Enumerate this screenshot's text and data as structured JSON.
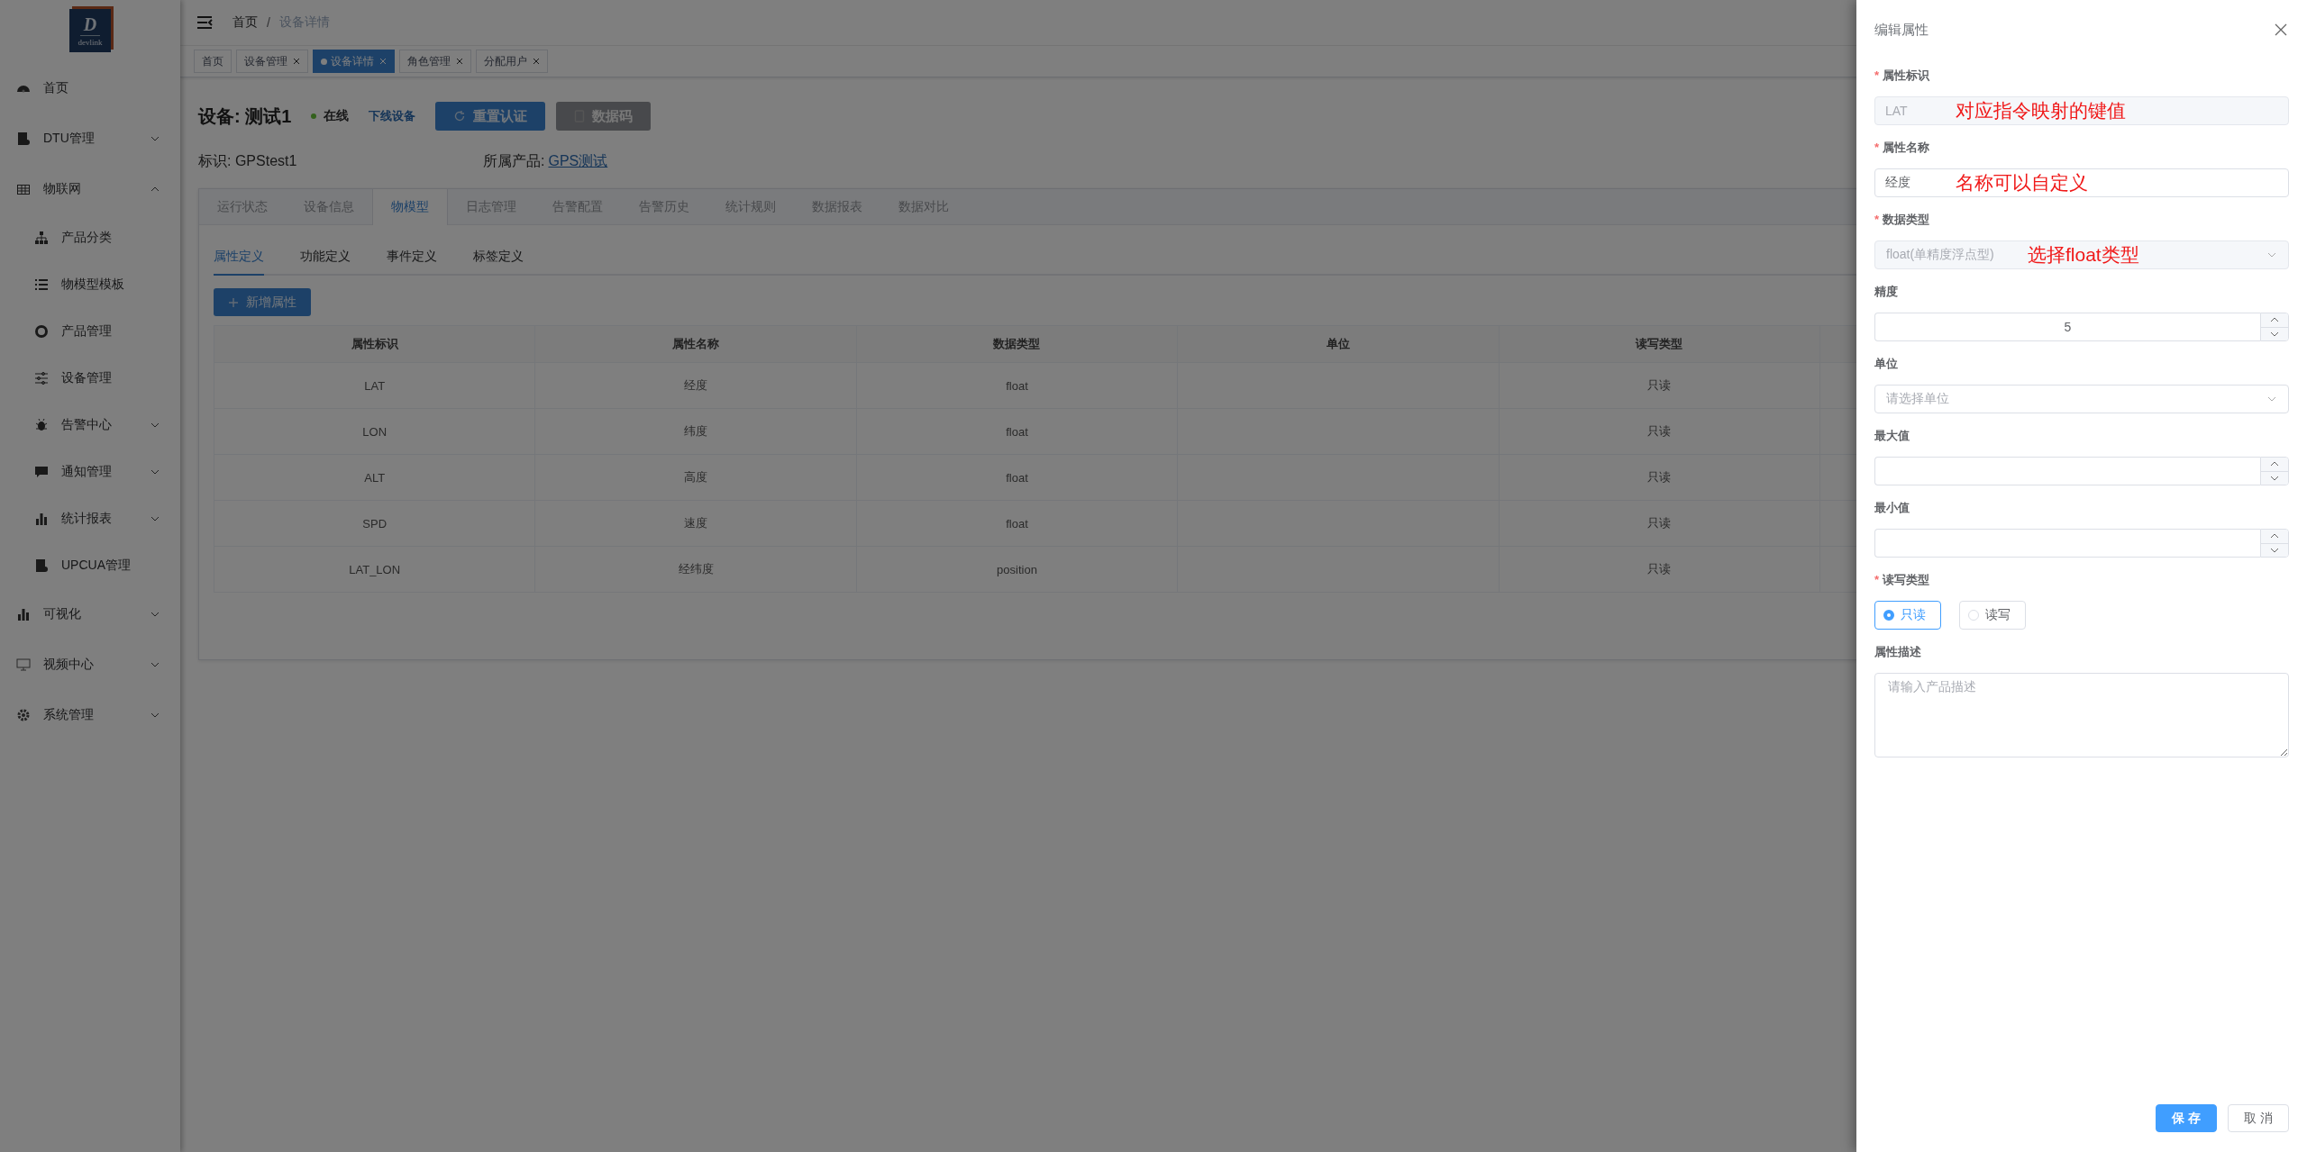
{
  "sidebar": {
    "logo": {
      "letter": "D",
      "text": "devlink"
    },
    "items": [
      {
        "label": "首页"
      },
      {
        "label": "DTU管理",
        "expanded": false
      },
      {
        "label": "物联网",
        "expanded": true,
        "children": [
          {
            "label": "产品分类"
          },
          {
            "label": "物模型模板"
          },
          {
            "label": "产品管理"
          },
          {
            "label": "设备管理"
          },
          {
            "label": "告警中心",
            "expanded": false
          },
          {
            "label": "通知管理",
            "expanded": false
          },
          {
            "label": "统计报表",
            "expanded": false
          },
          {
            "label": "UPCUA管理"
          }
        ]
      },
      {
        "label": "可视化",
        "expanded": false
      },
      {
        "label": "视频中心",
        "expanded": false
      },
      {
        "label": "系统管理",
        "expanded": false
      }
    ]
  },
  "breadcrumb": [
    "首页",
    "设备详情"
  ],
  "breadcrumb_separator": "/",
  "tags": [
    {
      "label": "首页",
      "selected": false,
      "closable": false
    },
    {
      "label": "设备管理",
      "selected": false,
      "closable": true
    },
    {
      "label": "设备详情",
      "selected": true,
      "closable": true
    },
    {
      "label": "角色管理",
      "selected": false,
      "closable": true
    },
    {
      "label": "分配用户",
      "selected": false,
      "closable": true
    }
  ],
  "device": {
    "title": "设备: 测试1",
    "status": {
      "label": "在线"
    },
    "offline_link": "下线设备",
    "buttons": [
      {
        "label": "重置认证",
        "kind": "primary"
      },
      {
        "label": "数据码",
        "kind": "dark"
      }
    ],
    "identifier": "标识: GPStest1",
    "product_label": "所属产品:",
    "product_link": "GPS测试"
  },
  "tabs": [
    {
      "label": "运行状态",
      "selected": false
    },
    {
      "label": "设备信息",
      "selected": false
    },
    {
      "label": "物模型",
      "selected": true
    },
    {
      "label": "日志管理",
      "selected": false
    },
    {
      "label": "告警配置",
      "selected": false
    },
    {
      "label": "告警历史",
      "selected": false
    },
    {
      "label": "统计规则",
      "selected": false
    },
    {
      "label": "数据报表",
      "selected": false
    },
    {
      "label": "数据对比",
      "selected": false
    }
  ],
  "subtabs": [
    {
      "label": "属性定义",
      "selected": true
    },
    {
      "label": "功能定义",
      "selected": false
    },
    {
      "label": "事件定义",
      "selected": false
    },
    {
      "label": "标签定义",
      "selected": false
    }
  ],
  "add_button": "新增属性",
  "table": {
    "columns": [
      "属性标识",
      "属性名称",
      "数据类型",
      "单位",
      "读写类型"
    ],
    "rows": [
      [
        "LAT",
        "经度",
        "float",
        "",
        "只读"
      ],
      [
        "LON",
        "纬度",
        "float",
        "",
        "只读"
      ],
      [
        "ALT",
        "高度",
        "float",
        "",
        "只读"
      ],
      [
        "SPD",
        "速度",
        "float",
        "",
        "只读"
      ],
      [
        "LAT_LON",
        "经纬度",
        "position",
        "",
        "只读"
      ]
    ]
  },
  "drawer": {
    "title": "编辑属性",
    "required_mark": "*",
    "fields": [
      {
        "label": "属性标识",
        "required": true,
        "kind": "text",
        "disabled": true,
        "value": "LAT",
        "annotation": "对应指令映射的键值"
      },
      {
        "label": "属性名称",
        "required": true,
        "kind": "text",
        "disabled": false,
        "value": "经度",
        "annotation": "名称可以自定义"
      },
      {
        "label": "数据类型",
        "required": true,
        "kind": "select",
        "disabled": true,
        "value": "float(单精度浮点型)",
        "annotation": "选择float类型"
      },
      {
        "label": "精度",
        "required": false,
        "kind": "number",
        "value": "5"
      },
      {
        "label": "单位",
        "required": false,
        "kind": "select",
        "placeholder": "请选择单位"
      },
      {
        "label": "最大值",
        "required": false,
        "kind": "number"
      },
      {
        "label": "最小值",
        "required": false,
        "kind": "number"
      },
      {
        "label": "读写类型",
        "required": true,
        "kind": "radio",
        "options": [
          {
            "label": "只读",
            "selected": true
          },
          {
            "label": "读写",
            "selected": false
          }
        ]
      },
      {
        "label": "属性描述",
        "required": false,
        "kind": "textarea",
        "placeholder": "请输入产品描述"
      }
    ],
    "buttons": [
      {
        "label": "保 存",
        "kind": "primary"
      },
      {
        "label": "取 消",
        "kind": "default"
      }
    ]
  }
}
